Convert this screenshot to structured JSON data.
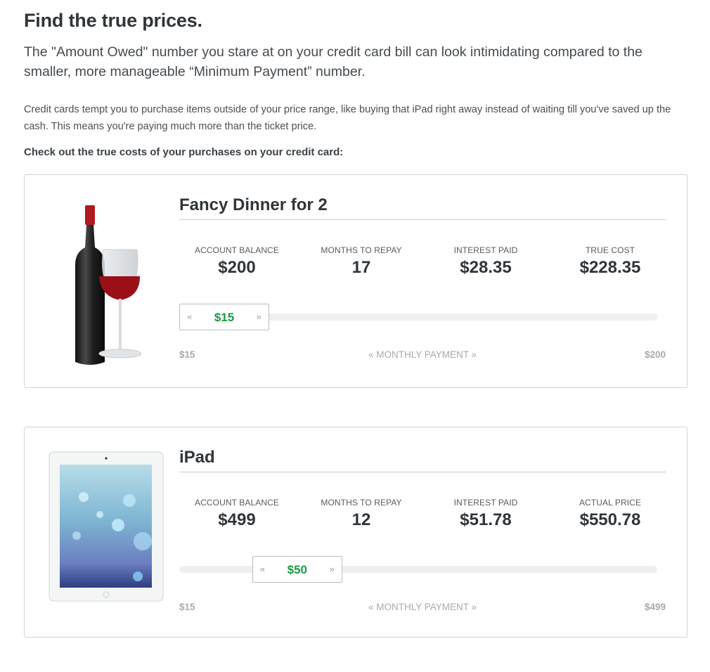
{
  "heading": "Find the true prices.",
  "lead": "The \"Amount Owed\" number you stare at on your credit card bill can look intimidating compared to the smaller, more manageable “Minimum Payment” number.",
  "body": "Credit cards tempt you to purchase items outside of your price range, like buying that iPad right away instead of waiting till you've saved up the cash. This means you're paying much more than the ticket price.",
  "callout": "Check out the true costs of your purchases on your credit card:",
  "cards": [
    {
      "title": "Fancy Dinner for 2",
      "image_icon": "wine-bottle-and-glass",
      "stats": [
        {
          "label": "ACCOUNT BALANCE",
          "value": "$200"
        },
        {
          "label": "MONTHS TO REPAY",
          "value": "17"
        },
        {
          "label": "INTEREST PAID",
          "value": "$28.35"
        },
        {
          "label": "TRUE COST",
          "value": "$228.35"
        }
      ],
      "slider": {
        "value_label": "$15",
        "value": 15,
        "min": 15,
        "max": 200,
        "left_arrow": "«",
        "right_arrow": "»",
        "min_label": "$15",
        "max_label": "$200",
        "center_label": "« MONTHLY PAYMENT »"
      }
    },
    {
      "title": "iPad",
      "image_icon": "tablet",
      "stats": [
        {
          "label": "ACCOUNT BALANCE",
          "value": "$499"
        },
        {
          "label": "MONTHS TO REPAY",
          "value": "12"
        },
        {
          "label": "INTEREST PAID",
          "value": "$51.78"
        },
        {
          "label": "ACTUAL PRICE",
          "value": "$550.78"
        }
      ],
      "slider": {
        "value_label": "$50",
        "value": 50,
        "min": 15,
        "max": 499,
        "left_arrow": "«",
        "right_arrow": "»",
        "min_label": "$15",
        "max_label": "$499",
        "center_label": "« MONTHLY PAYMENT »"
      }
    }
  ],
  "colors": {
    "accent_green": "#1a9b3f",
    "wine_red": "#b0191e",
    "border": "#cfd3d6"
  }
}
